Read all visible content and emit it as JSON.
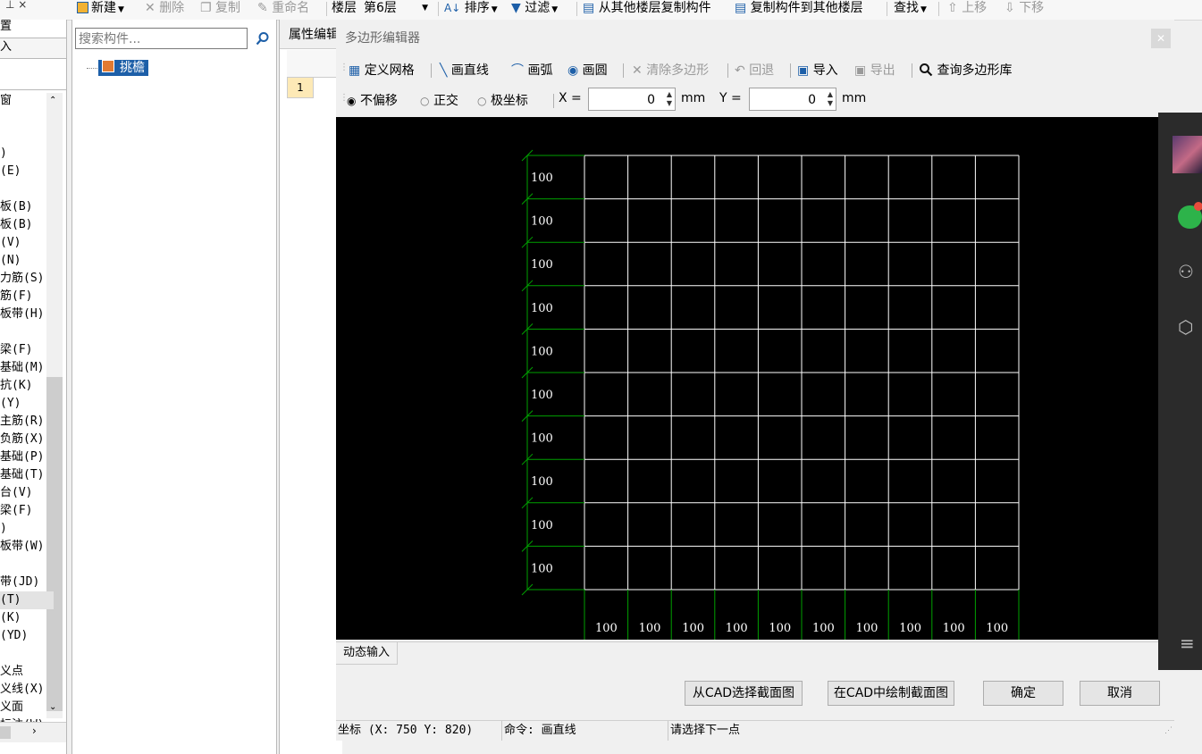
{
  "toolbar": {
    "new_label": "新建",
    "delete_label": "删除",
    "copy_label": "复制",
    "rename_label": "重命名",
    "floor_label": "楼层",
    "floor_value": "第6层",
    "sort_label": "排序",
    "filter_label": "过滤",
    "copy_from_floor_label": "从其他楼层复制构件",
    "copy_to_floor_label": "复制构件到其他楼层",
    "find_label": "查找",
    "up_label": "上移",
    "down_label": "下移"
  },
  "left_panel": {
    "top_items": [
      "置",
      "入",
      "窗"
    ],
    "items": [
      ")",
      "(E)",
      "",
      "板(B)",
      "板(B)",
      "(V)",
      "(N)",
      "力筋(S)",
      "筋(F)",
      "板带(H)",
      "",
      "梁(F)",
      "基础(M)",
      "抗(K)",
      "(Y)",
      "主筋(R)",
      "负筋(X)",
      "基础(P)",
      "基础(T)",
      "台(V)",
      "梁(F)",
      ")",
      "板带(W)",
      "",
      "带(JD)",
      "(T)",
      "(K)",
      "(YD)",
      "",
      "义点",
      "义线(X)",
      "义面",
      "标注(W)"
    ]
  },
  "tree": {
    "search_placeholder": "搜索构件...",
    "node_label": "挑檐"
  },
  "props": {
    "tab_label": "属性编辑",
    "row_number": "1"
  },
  "dialog": {
    "title": "多边形编辑器",
    "tools": {
      "define_grid": "定义网格",
      "draw_line": "画直线",
      "draw_arc": "画弧",
      "draw_circle": "画圆",
      "clear_polygon": "清除多边形",
      "undo": "回退",
      "import": "导入",
      "export": "导出",
      "query_library": "查询多边形库"
    },
    "coords": {
      "mode_none": "不偏移",
      "mode_ortho": "正交",
      "mode_polar": "极坐标",
      "x_label": "X =",
      "x_value": "0",
      "x_unit": "mm",
      "y_label": "Y =",
      "y_value": "0",
      "y_unit": "mm"
    },
    "grid": {
      "row_labels": [
        "100",
        "100",
        "100",
        "100",
        "100",
        "100",
        "100",
        "100",
        "100",
        "100"
      ],
      "col_labels": [
        "100",
        "100",
        "100",
        "100",
        "100",
        "100",
        "100",
        "100",
        "100",
        "100"
      ],
      "grid_color": "#ffffff",
      "dim_color": "#00a000"
    },
    "dynamic_input_tab": "动态输入",
    "buttons": {
      "select_from_cad": "从CAD选择截面图",
      "draw_in_cad": "在CAD中绘制截面图",
      "ok": "确定",
      "cancel": "取消"
    },
    "status": {
      "coord": "坐标 (X: 750 Y: 820)",
      "command": "命令: 画直线",
      "prompt": "请选择下一点"
    }
  },
  "colors": {
    "accent": "#1d5fa8",
    "canvas_bg": "#000000",
    "side_panel": "#2b2b2b",
    "notify_green": "#2db34a"
  }
}
